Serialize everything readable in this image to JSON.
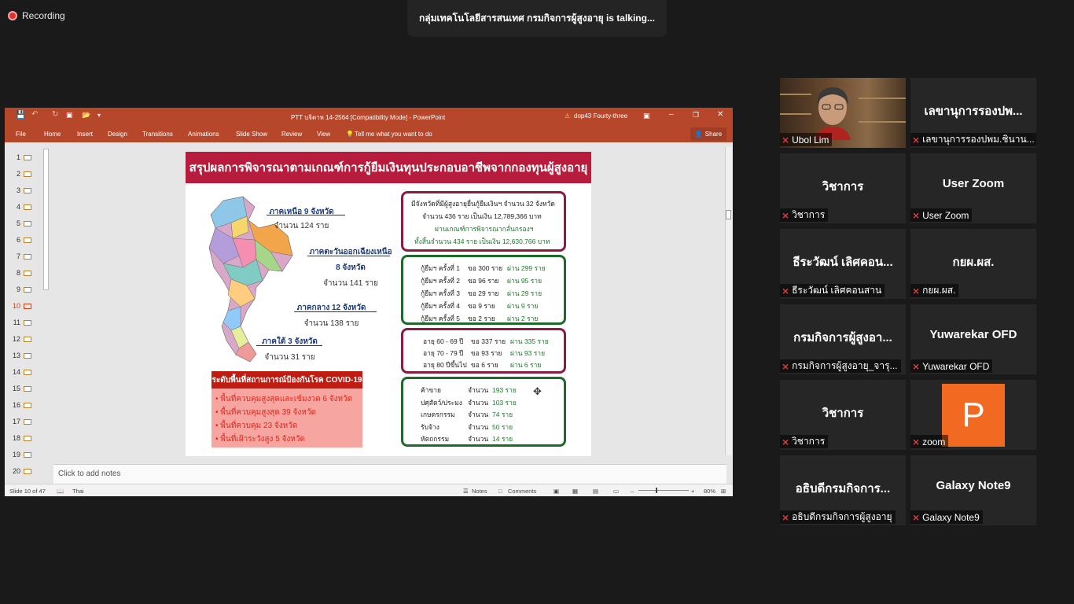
{
  "recording": {
    "label": "Recording"
  },
  "talking": {
    "text": "กลุ่มเทคโนโลยีสารสนเทศ กรมกิจการผู้สูงอายุ  is  talking..."
  },
  "ppt": {
    "title": "PTT บจิตาห 14-2564 [Compatibility Mode]  -  PowerPoint",
    "account": "dop43 Fourty-three",
    "tabs": [
      "File",
      "Home",
      "Insert",
      "Design",
      "Transitions",
      "Animations",
      "Slide Show",
      "Review",
      "View"
    ],
    "tell_me": "Tell me what you want to do",
    "share_label": "Share",
    "slide_numbers": [
      "1",
      "2",
      "3",
      "4",
      "5",
      "6",
      "7",
      "8",
      "9",
      "10",
      "11",
      "12",
      "13",
      "14",
      "15",
      "16",
      "17",
      "18",
      "19",
      "20"
    ],
    "active_slide": "10",
    "notes_placeholder": "Click to add notes",
    "status": {
      "slide_info": "Slide 10 of 47",
      "language": "Thai",
      "notes": "Notes",
      "comments": "Comments",
      "zoom": "80%"
    }
  },
  "slide": {
    "title": "สรุปผลการพิจารณาตามเกณฑ์การกู้ยืมเงินทุนประกอบอาชีพจากกองทุนผู้สูงอายุ",
    "regions": {
      "north": {
        "name": "ภาคเหนือ 9 จังหวัด",
        "count": "จำนวน 124 ราย"
      },
      "northeast": {
        "name": "ภาคตะวันออกเฉียงเหนือ",
        "provinces": "8 จังหวัด",
        "count": "จำนวน 141 ราย"
      },
      "central": {
        "name": "ภาคกลาง 12 จังหวัด",
        "count": "จำนวน 138 ราย"
      },
      "south": {
        "name": "ภาคใต้ 3 จังหวัด",
        "count": "จำนวน 31 ราย"
      }
    },
    "summary": {
      "line1": "มีจังหวัดที่มีผู้สูงอายุยื่นกู้ยืมเงินฯ จำนวน 32 จังหวัด",
      "line2": "จำนวน 436 ราย เป็นเงิน 12,789,366 บาท",
      "line3": "ผ่านเกณฑ์การพิจารณากลั่นกรองฯ",
      "line4": "ทั้งสิ้นจำนวน 434 ราย เป็นเงิน 12,630,766 บาท"
    },
    "loan_rounds": [
      {
        "round": "กู้ยืมฯ ครั้งที่ 1",
        "req": "ขอ  300 ราย",
        "pass": "ผ่าน 299 ราย"
      },
      {
        "round": "กู้ยืมฯ ครั้งที่ 2",
        "req": "ขอ    96 ราย",
        "pass": "ผ่าน    95 ราย"
      },
      {
        "round": "กู้ยืมฯ ครั้งที่ 3",
        "req": "ขอ    29 ราย",
        "pass": "ผ่าน    29 ราย"
      },
      {
        "round": "กู้ยืมฯ ครั้งที่ 4",
        "req": "ขอ      9 ราย",
        "pass": "ผ่าน      9 ราย"
      },
      {
        "round": "กู้ยืมฯ ครั้งที่ 5",
        "req": "ขอ      2 ราย",
        "pass": "ผ่าน      2 ราย"
      }
    ],
    "ages": [
      {
        "age": "อายุ 60 - 69 ปี",
        "req": "ขอ  337 ราย",
        "pass": "ผ่าน 335 ราย"
      },
      {
        "age": "อายุ 70 - 79 ปี",
        "req": "ขอ    93 ราย",
        "pass": "ผ่าน  93 ราย"
      },
      {
        "age": "อายุ 80 ปีขึ้นไป",
        "req": "ขอ      6 ราย",
        "pass": "ผ่าน    6 ราย"
      }
    ],
    "occupations": [
      {
        "name": "ค้าขาย",
        "count_label": "จำนวน",
        "value": "193 ราย"
      },
      {
        "name": "ปศุสัตว์/ประมง",
        "count_label": "จำนวน",
        "value": "103 ราย"
      },
      {
        "name": "เกษตรกรรม",
        "count_label": "จำนวน",
        "value": "74 ราย"
      },
      {
        "name": "รับจ้าง",
        "count_label": "จำนวน",
        "value": "50 ราย"
      },
      {
        "name": "หัตถกรรม",
        "count_label": "จำนวน",
        "value": "14 ราย"
      }
    ],
    "covid": {
      "title": "ระดับพื้นที่สถานการณ์ป้องกันโรค COVID-19",
      "items": [
        "• พื้นที่ควบคุมสูงสุดและเข้มงวด 6 จังหวัด",
        "• พื้นที่ควบคุมสูงสุด 39 จังหวัด",
        "• พื้นที่ควบคุม 23 จังหวัด",
        "• พื้นที่เฝ้าระวังสูง 5 จังหวัด"
      ]
    }
  },
  "participants": [
    {
      "big": "",
      "label": "Ubol Lim",
      "video": true
    },
    {
      "big": "เลขานุการรองปพ...",
      "label": "เลขานุการรองปพม.ชินาน..."
    },
    {
      "big": "วิชาการ",
      "label": "วิชาการ"
    },
    {
      "big": "User Zoom",
      "label": "User Zoom"
    },
    {
      "big": "ธีระวัฒน์ เลิศคอน...",
      "label": "ธีระวัฒน์ เลิศคอนสาน"
    },
    {
      "big": "กยผ.ผส.",
      "label": "กยผ.ผส."
    },
    {
      "big": "กรมกิจการผู้สูงอา...",
      "label": "กรมกิจการผู้สูงอายุ_จารุ..."
    },
    {
      "big": "Yuwarekar OFD",
      "label": "Yuwarekar OFD"
    },
    {
      "big": "วิชาการ",
      "label": "วิชาการ"
    },
    {
      "big": "P",
      "label": "zoom",
      "avatar": true
    },
    {
      "big": "อธิบดีกรมกิจการ...",
      "label": "อธิบดีกรมกิจการผู้สูงอายุ"
    },
    {
      "big": "Galaxy Note9",
      "label": "Galaxy Note9"
    }
  ],
  "colors": {
    "ppt_accent": "#b7472a",
    "slide_title": "#b81c3c",
    "box_red": "#8e1b3e",
    "box_green": "#1d6b2a",
    "zoom_avatar": "#f26a21",
    "mute_red": "#e23b3b"
  }
}
